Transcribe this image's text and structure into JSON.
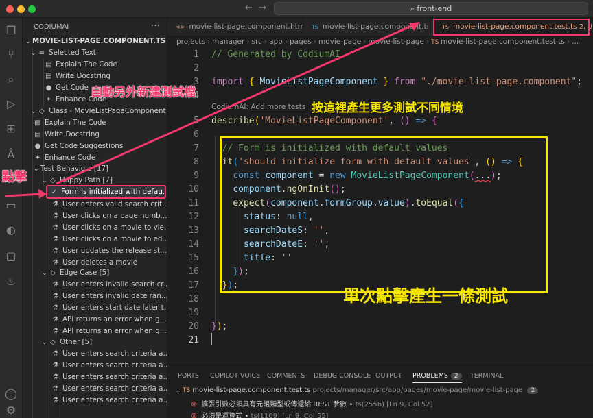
{
  "window": {
    "search_label": "front-end",
    "nav_back": "←",
    "nav_forward": "→"
  },
  "activity_bar": [
    "files-icon",
    "source-control-icon",
    "search-icon",
    "run-debug-icon",
    "extensions-icon",
    "angular-icon",
    "remote-icon",
    "chat-icon",
    "codium-icon",
    "comment-icon",
    "genie-icon",
    "account-icon",
    "settings-icon"
  ],
  "sidebar": {
    "header": "CODIUMAI",
    "section": "MOVIE-LIST-PAGE.COMPONENT.TS",
    "items": [
      {
        "label": "Selected Text",
        "icon": "≡"
      },
      {
        "label": "Explain The Code",
        "icon": "▤"
      },
      {
        "label": "Write Docstring",
        "icon": "▤"
      },
      {
        "label": "Get Code",
        "icon": "💡"
      },
      {
        "label": "Enhance Code",
        "icon": "✦"
      },
      {
        "label": "Class - MovieListPageComponent",
        "icon": "⌂"
      },
      {
        "label": "Explain The Code",
        "icon": "▤"
      },
      {
        "label": "Write Docstring",
        "icon": "▤"
      },
      {
        "label": "Get Code Suggestions",
        "icon": "💡"
      },
      {
        "label": "Enhance Code",
        "icon": "✦"
      },
      {
        "label": "Test Behaviors [17]",
        "icon": ""
      },
      {
        "label": "Happy Path [7]",
        "icon": "⌂"
      },
      {
        "label": "Form is initialized with defau...",
        "icon": "✓✓"
      },
      {
        "label": "User enters valid search crit...",
        "icon": "⚗"
      },
      {
        "label": "User clicks on a page numb...",
        "icon": "⚗"
      },
      {
        "label": "User clicks on a movie to vie...",
        "icon": "⚗"
      },
      {
        "label": "User clicks on a movie to ed...",
        "icon": "⚗"
      },
      {
        "label": "User updates the release st...",
        "icon": "⚗"
      },
      {
        "label": "User deletes a movie",
        "icon": "⚗"
      },
      {
        "label": "Edge Case [5]",
        "icon": "⌂"
      },
      {
        "label": "User enters invalid search cr...",
        "icon": "⚗"
      },
      {
        "label": "User enters invalid date ran...",
        "icon": "⚗"
      },
      {
        "label": "User enters start date later t...",
        "icon": "⚗"
      },
      {
        "label": "API returns an error when g...",
        "icon": "⚗"
      },
      {
        "label": "API returns an error when g...",
        "icon": "⚗"
      },
      {
        "label": "Other [5]",
        "icon": "⌂"
      },
      {
        "label": "User enters search criteria a...",
        "icon": "⚗"
      },
      {
        "label": "User enters search criteria a...",
        "icon": "⚗"
      },
      {
        "label": "User enters search criteria a...",
        "icon": "⚗"
      },
      {
        "label": "User enters search criteria a...",
        "icon": "⚗"
      },
      {
        "label": "User enters search criteria a...",
        "icon": "⚗"
      }
    ]
  },
  "tabs": [
    {
      "label": "movie-list-page.component.html",
      "icon": "<>"
    },
    {
      "label": "movie-list-page.component.ts",
      "icon": "TS"
    },
    {
      "label": "movie-list-page.component.test.ts",
      "icon": "TS",
      "suffix": "2, U"
    }
  ],
  "breadcrumb": [
    "projects",
    "manager",
    "src",
    "app",
    "pages",
    "movie-page",
    "movie-list-page",
    "movie-list-page.component.test.ts",
    "..."
  ],
  "editor": {
    "codelens": "CodiumAI: ",
    "codelens_link": "Add more tests",
    "line_numbers": [
      "1",
      "2",
      "3",
      "4",
      "5",
      "6",
      "7",
      "8",
      "9",
      "10",
      "11",
      "12",
      "13",
      "14",
      "15",
      "16",
      "17",
      "18",
      "19",
      "20",
      "21"
    ]
  },
  "panel": {
    "tabs": [
      "PORTS",
      "COPILOT VOICE",
      "COMMENTS",
      "DEBUG CONSOLE",
      "OUTPUT",
      "PROBLEMS",
      "TERMINAL"
    ],
    "problems_count": "2",
    "file": "movie-list-page.component.test.ts",
    "file_path": "projects/manager/src/app/pages/movie-page/movie-list-page",
    "file_count": "2",
    "errors": [
      {
        "message": "擴張引數必須具有元組類型或傳遞給 REST 參數 •",
        "source": "ts(2556)",
        "location": "[Ln 9, Col 52]"
      },
      {
        "message": "必須是運算式 •",
        "source": "ts(1109)",
        "location": "[Ln 9, Col 55]"
      }
    ]
  },
  "annotations": {
    "auto_create": "自動另外新建測試檔",
    "click": "點擊",
    "more_tests": "按這裡產生更多測試不同情境",
    "single_click": "單次點擊產生一條測試"
  },
  "colors": {
    "annotation_pink": "#f4386b",
    "annotation_yellow": "#f7e600",
    "editor_bg": "#1e1e1e"
  }
}
